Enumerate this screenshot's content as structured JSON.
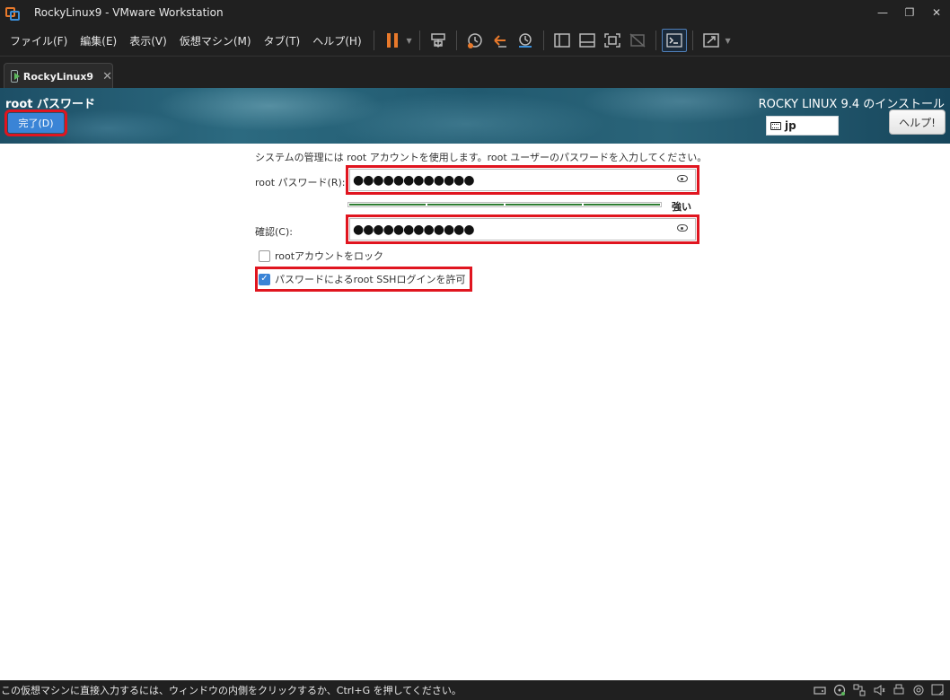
{
  "window": {
    "title": "RockyLinux9 - VMware Workstation",
    "minimize": "—",
    "restore": "❐",
    "close": "✕"
  },
  "menu": [
    {
      "label": "ファイル(F)"
    },
    {
      "label": "編集(E)"
    },
    {
      "label": "表示(V)"
    },
    {
      "label": "仮想マシン(M)"
    },
    {
      "label": "タブ(T)"
    },
    {
      "label": "ヘルプ(H)"
    }
  ],
  "toolbar": {
    "icons": [
      "pause-icon",
      "send-keys-icon",
      "snapshot-icon",
      "revert-snapshot-icon",
      "snapshot-manager-icon",
      "library-view-icon",
      "thumbnail-bar-icon",
      "fullscreen-icon",
      "unity-icon",
      "console-view-icon",
      "stretch-guest-icon"
    ]
  },
  "tab": {
    "label": "RockyLinux9",
    "close": "✕"
  },
  "installer": {
    "spoke_title": "root パスワード",
    "done_label": "完了(D)",
    "install_title": "ROCKY LINUX 9.4 のインストール",
    "keyboard_layout": "jp",
    "help_label": "ヘルプ!",
    "instructions": "システムの管理には root アカウントを使用します。root ユーザーのパスワードを入力してください。",
    "password_label": "root パスワード(R):",
    "password_value": "●●●●●●●●●●●●",
    "strength_label": "強い",
    "strength_level": 1.0,
    "confirm_label": "確認(C):",
    "confirm_value": "●●●●●●●●●●●●",
    "lock_root_label": "rootアカウントをロック",
    "lock_root_checked": false,
    "allow_ssh_label": "パスワードによるroot SSHログインを許可",
    "allow_ssh_checked": true
  },
  "status": {
    "text": "この仮想マシンに直接入力するには、ウィンドウの内側をクリックするか、Ctrl+G を押してください。"
  },
  "colors": {
    "highlight": "#e0151f",
    "accent": "#3a84d6",
    "strength": "#2e7d32",
    "pause": "#e8792b"
  }
}
